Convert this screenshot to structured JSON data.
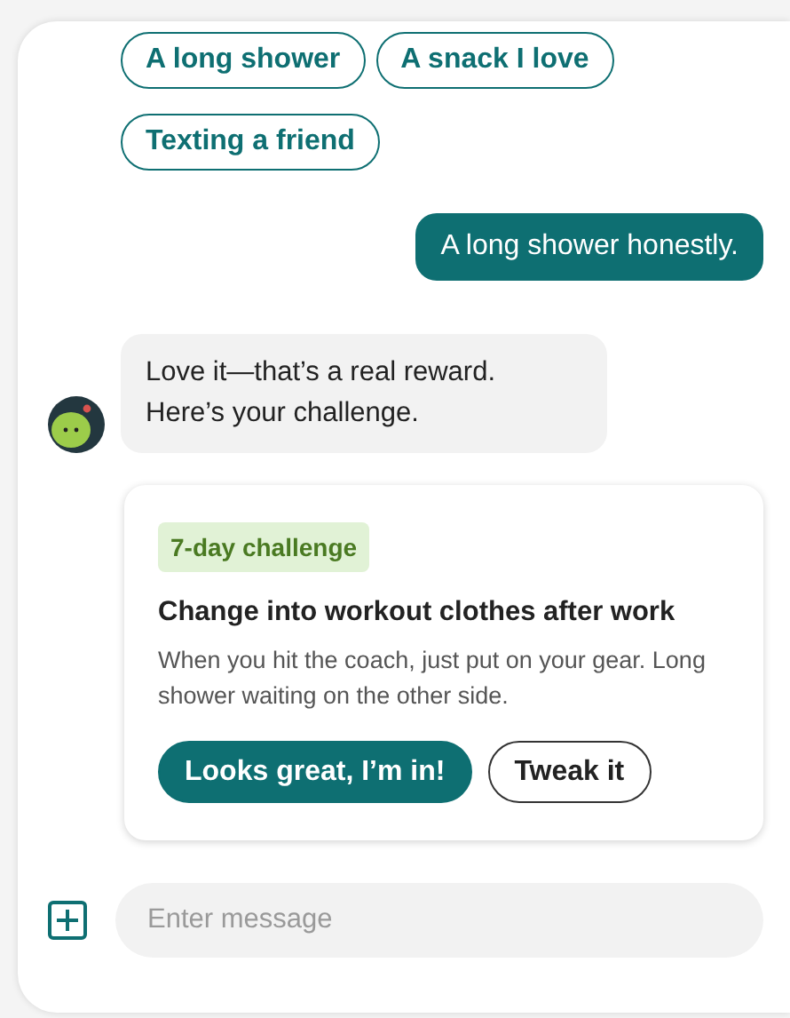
{
  "suggestions": [
    "A long shower",
    "A snack I love",
    "Texting a friend"
  ],
  "user_message": "A long shower honestly.",
  "bot_message": [
    "Love it—that’s a real reward.",
    "Here’s your challenge."
  ],
  "challenge_card": {
    "tag": "7-day challenge",
    "title": "Change into workout clothes after work",
    "description": "When you hit the coach, just put on your gear. Long shower waiting on the other side.",
    "buttons": [
      {
        "label": "Looks great, I’m in!",
        "kind": "primary"
      },
      {
        "label": "Tweak it",
        "kind": "secondary"
      }
    ]
  },
  "composer": {
    "placeholder": "Enter message"
  }
}
